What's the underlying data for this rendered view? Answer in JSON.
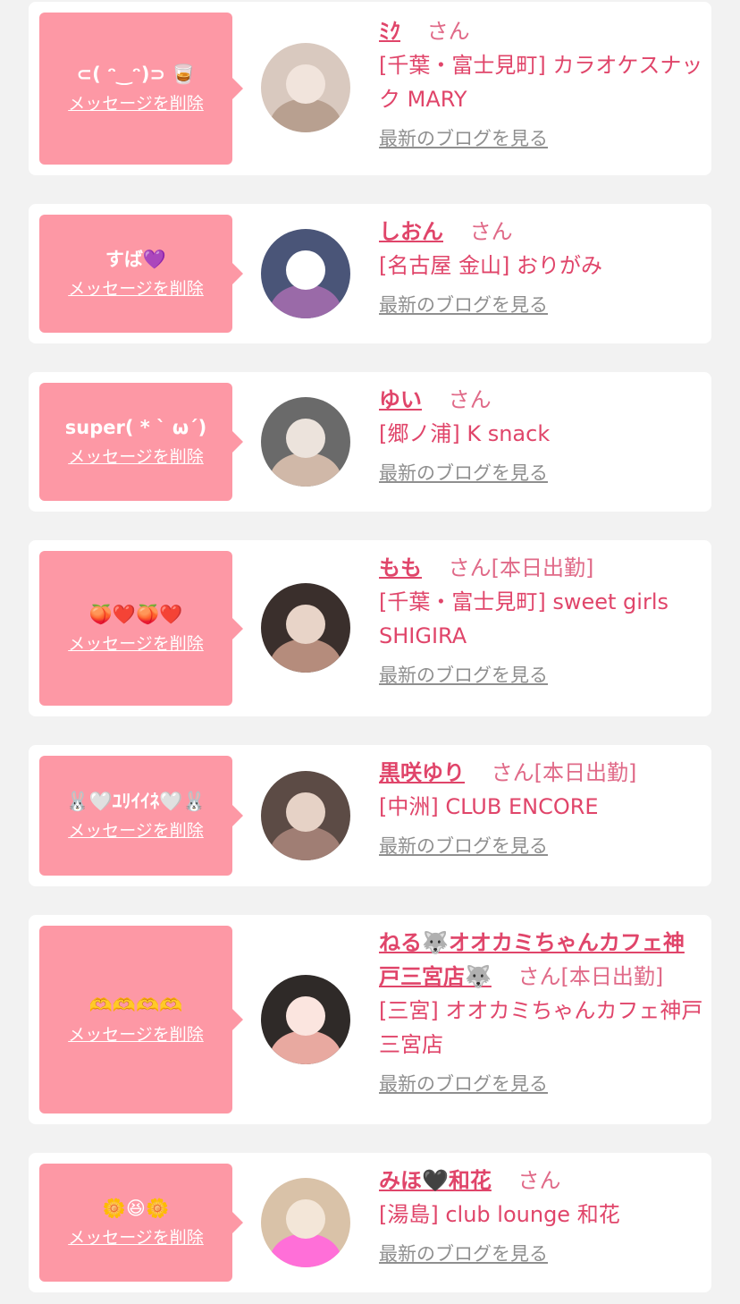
{
  "delete_label": "メッセージを削除",
  "blog_label": "最新のブログを見る",
  "san_label": "さん",
  "colors": {
    "bubble": "#fd98a5",
    "name": "#e0456a",
    "link_gray": "#8f8f8f",
    "card": "#ffffff",
    "page_bg": "#f2f2f2"
  },
  "cards": [
    {
      "message": "⊂( ᵔ‿ᵔ)⊃ 🥃",
      "name": "ﾐｸ",
      "badge": "",
      "shop": "[千葉・富士見町] カラオケスナック MARY"
    },
    {
      "message": "すば💜",
      "name": "しおん",
      "badge": "",
      "shop": "[名古屋 金山] おりがみ"
    },
    {
      "message": "super( * ˋ ω´)",
      "name": "ゆい",
      "badge": "",
      "shop": "[郷ノ浦] K snack"
    },
    {
      "message": "🍑❤️🍑❤️",
      "name": "もも",
      "badge": "[本日出勤]",
      "shop": "[千葉・富士見町] sweet girls SHIGIRA"
    },
    {
      "message": "🐰🤍ﾕﾘｲｲﾈ🤍🐰",
      "name": "黒咲ゆり",
      "badge": "[本日出勤]",
      "shop": "[中洲] CLUB ENCORE"
    },
    {
      "message": "🫶🫶🫶🫶",
      "name": "ねる🐺オオカミちゃんカフェ神戸三宮店🐺",
      "badge": "[本日出勤]",
      "shop": "[三宮] オオカミちゃんカフェ神戸三宮店"
    },
    {
      "message": "🌼😆🌼",
      "name": "みほ🖤和花",
      "badge": "",
      "shop": "[湯島] club lounge 和花"
    }
  ]
}
